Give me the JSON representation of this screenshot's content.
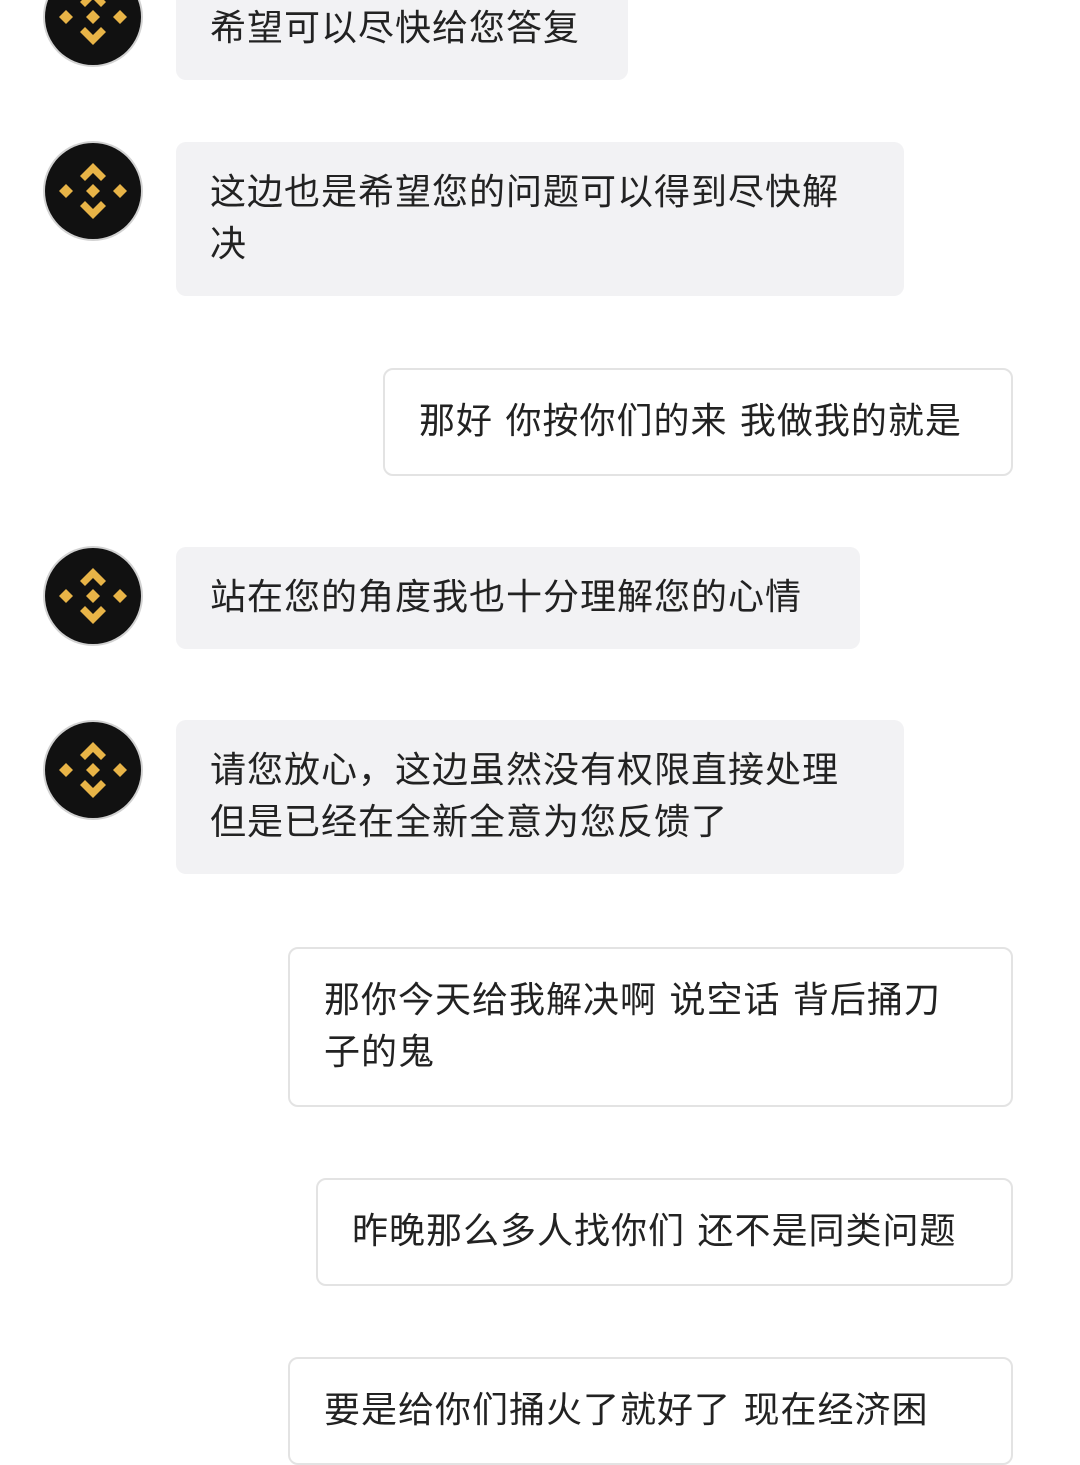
{
  "colors": {
    "agent_bubble_bg": "#f2f2f4",
    "user_bubble_bg": "#ffffff",
    "user_bubble_border": "#e3e3e3",
    "avatar_bg": "#111111",
    "brand_gold": "#e8b447",
    "text": "#222222"
  },
  "avatar_icon": "binance-logo-icon",
  "messages": [
    {
      "sender": "agent",
      "text": "希望可以尽快给您答复"
    },
    {
      "sender": "agent",
      "text": "这边也是希望您的问题可以得到尽快解决"
    },
    {
      "sender": "user",
      "text": "那好 你按你们的来 我做我的就是"
    },
    {
      "sender": "agent",
      "text": "站在您的角度我也十分理解您的心情"
    },
    {
      "sender": "agent",
      "text": "请您放心，这边虽然没有权限直接处理但是已经在全新全意为您反馈了"
    },
    {
      "sender": "user",
      "text": "那你今天给我解决啊 说空话 背后捅刀子的鬼"
    },
    {
      "sender": "user",
      "text": "昨晚那么多人找你们 还不是同类问题"
    },
    {
      "sender": "user",
      "text": "要是给你们捅火了就好了 现在经济困"
    }
  ]
}
